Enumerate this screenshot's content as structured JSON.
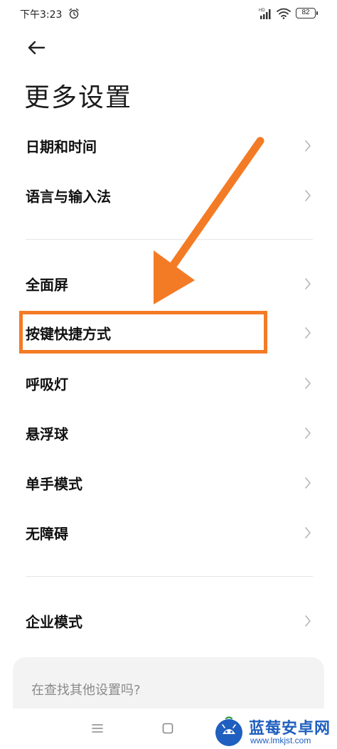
{
  "status_bar": {
    "time": "下午3:23",
    "battery": "82",
    "network": "HD"
  },
  "header": {
    "title": "更多设置"
  },
  "sections": [
    {
      "items": [
        {
          "label": "日期和时间"
        },
        {
          "label": "语言与输入法"
        }
      ]
    },
    {
      "items": [
        {
          "label": "全面屏"
        },
        {
          "label": "按键快捷方式"
        },
        {
          "label": "呼吸灯"
        },
        {
          "label": "悬浮球"
        },
        {
          "label": "单手模式"
        },
        {
          "label": "无障碍"
        }
      ]
    },
    {
      "items": [
        {
          "label": "企业模式"
        }
      ]
    }
  ],
  "search_card": {
    "text": "在查找其他设置吗?"
  },
  "watermark": {
    "title": "蓝莓安卓网",
    "url": "www.lmkjst.com"
  },
  "colors": {
    "annotation": "#f47b25",
    "watermark": "#1f5fbf",
    "chevron": "#b5b5b5"
  },
  "highlighted_item": "按键快捷方式"
}
